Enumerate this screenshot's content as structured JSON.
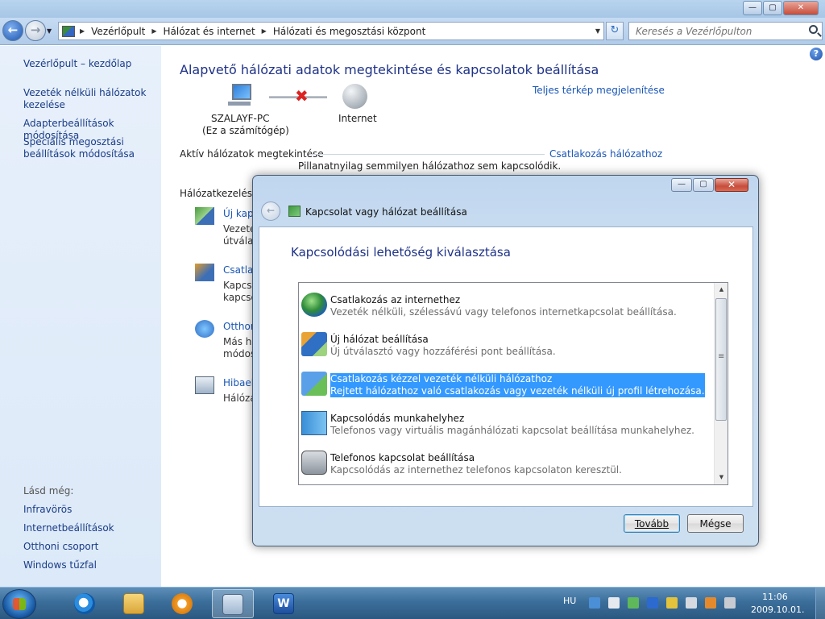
{
  "window": {
    "caption_buttons": {
      "minimize": "—",
      "maximize": "▢",
      "close": "✕"
    }
  },
  "navbar": {
    "breadcrumbs": [
      "Vezérlőpult",
      "Hálózat és internet",
      "Hálózati és megosztási központ"
    ],
    "search_placeholder": "Keresés a Vezérlőpulton"
  },
  "sidebar": {
    "home": "Vezérlőpult – kezdőlap",
    "links": [
      "Vezeték nélküli hálózatok kezelése",
      "Adapterbeállítások módosítása",
      "Speciális megosztási beállítások módosítása"
    ],
    "see_also_label": "Lásd még:",
    "see_also": [
      "Infravörös",
      "Internetbeállítások",
      "Otthoni csoport",
      "Windows tűzfal"
    ]
  },
  "main": {
    "title": "Alapvető hálózati adatok megtekintése és kapcsolatok beállítása",
    "full_map_link": "Teljes térkép megjelenítése",
    "computer_name": "SZALAYF-PC",
    "computer_sub": "(Ez a számítógép)",
    "internet_label": "Internet",
    "active_networks": "Aktív hálózatok megtekintése",
    "connect_link": "Csatlakozás hálózathoz",
    "no_connection": "Pillanatnyilag semmilyen hálózathoz sem kapcsolódik.",
    "network_mgmt_partial": "Hálózatkezelési b",
    "tasks": [
      {
        "title": "Új kapc",
        "desc1": "Vezeték",
        "desc2": "útválasz"
      },
      {
        "title": "Csatlak",
        "desc1": "Kapcsol",
        "desc2": "kapcsol"
      },
      {
        "title": "Otthon",
        "desc1": "Más há",
        "desc2": "módos"
      },
      {
        "title": "Hibaell",
        "desc1": "Hálóza",
        "desc2": ""
      }
    ]
  },
  "dialog": {
    "title": "Kapcsolat vagy hálózat beállítása",
    "heading": "Kapcsolódási lehetőség kiválasztása",
    "options": [
      {
        "title": "Csatlakozás az internethez",
        "desc": "Vezeték nélküli, szélessávú vagy telefonos internetkapcsolat beállítása.",
        "icon": "globe-icon"
      },
      {
        "title": "Új hálózat beállítása",
        "desc": "Új útválasztó vagy hozzáférési pont beállítása.",
        "icon": "network-setup-icon"
      },
      {
        "title": "Csatlakozás kézzel vezeték nélküli hálózathoz",
        "desc": "Rejtett hálózathoz való csatlakozás vagy vezeték nélküli új profil létrehozása.",
        "icon": "wireless-network-icon",
        "selected": true
      },
      {
        "title": "Kapcsolódás munkahelyhez",
        "desc": "Telefonos vagy virtuális magánhálózati kapcsolat beállítása munkahelyhez.",
        "icon": "workplace-icon"
      },
      {
        "title": "Telefonos kapcsolat beállítása",
        "desc": "Kapcsolódás az internethez telefonos kapcsolaton keresztül.",
        "icon": "dialup-phone-icon"
      }
    ],
    "next_label": "Tovább",
    "cancel_label": "Mégse"
  },
  "taskbar": {
    "language": "HU",
    "time": "11:06",
    "date": "2009.10.01.",
    "word_glyph": "W"
  }
}
